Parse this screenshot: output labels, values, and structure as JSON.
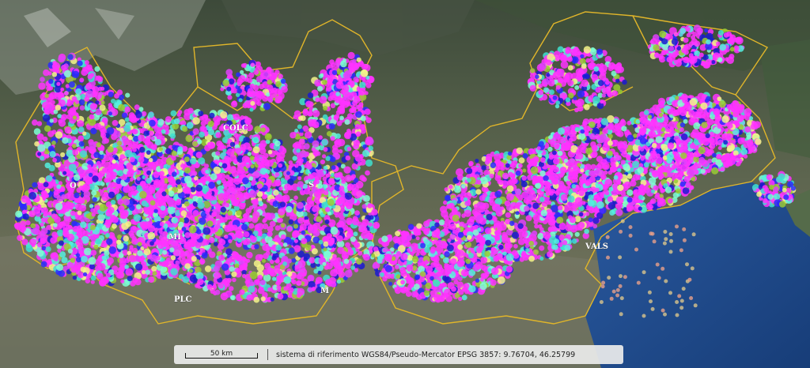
{
  "map": {
    "place_labels": [
      {
        "text": "COLC"
      },
      {
        "text": "O"
      },
      {
        "text": "S"
      },
      {
        "text": "MI"
      },
      {
        "text": "PLC"
      },
      {
        "text": "M"
      },
      {
        "text": "VALS"
      }
    ],
    "colors": {
      "sea": "#1f4a8a",
      "border": "#e0b52a",
      "points": [
        "#ff33ff",
        "#e040fb",
        "#2a2aff",
        "#1a1ad0",
        "#55f0e0",
        "#7fffd4",
        "#f5f58a",
        "#9acd32",
        "#40e0d0"
      ]
    }
  },
  "statusbar": {
    "scale_label": "50 km",
    "crs_text": "sistema di riferimento WGS84/Pseudo-Mercator EPSG 3857: 9.76704, 46.25799"
  }
}
